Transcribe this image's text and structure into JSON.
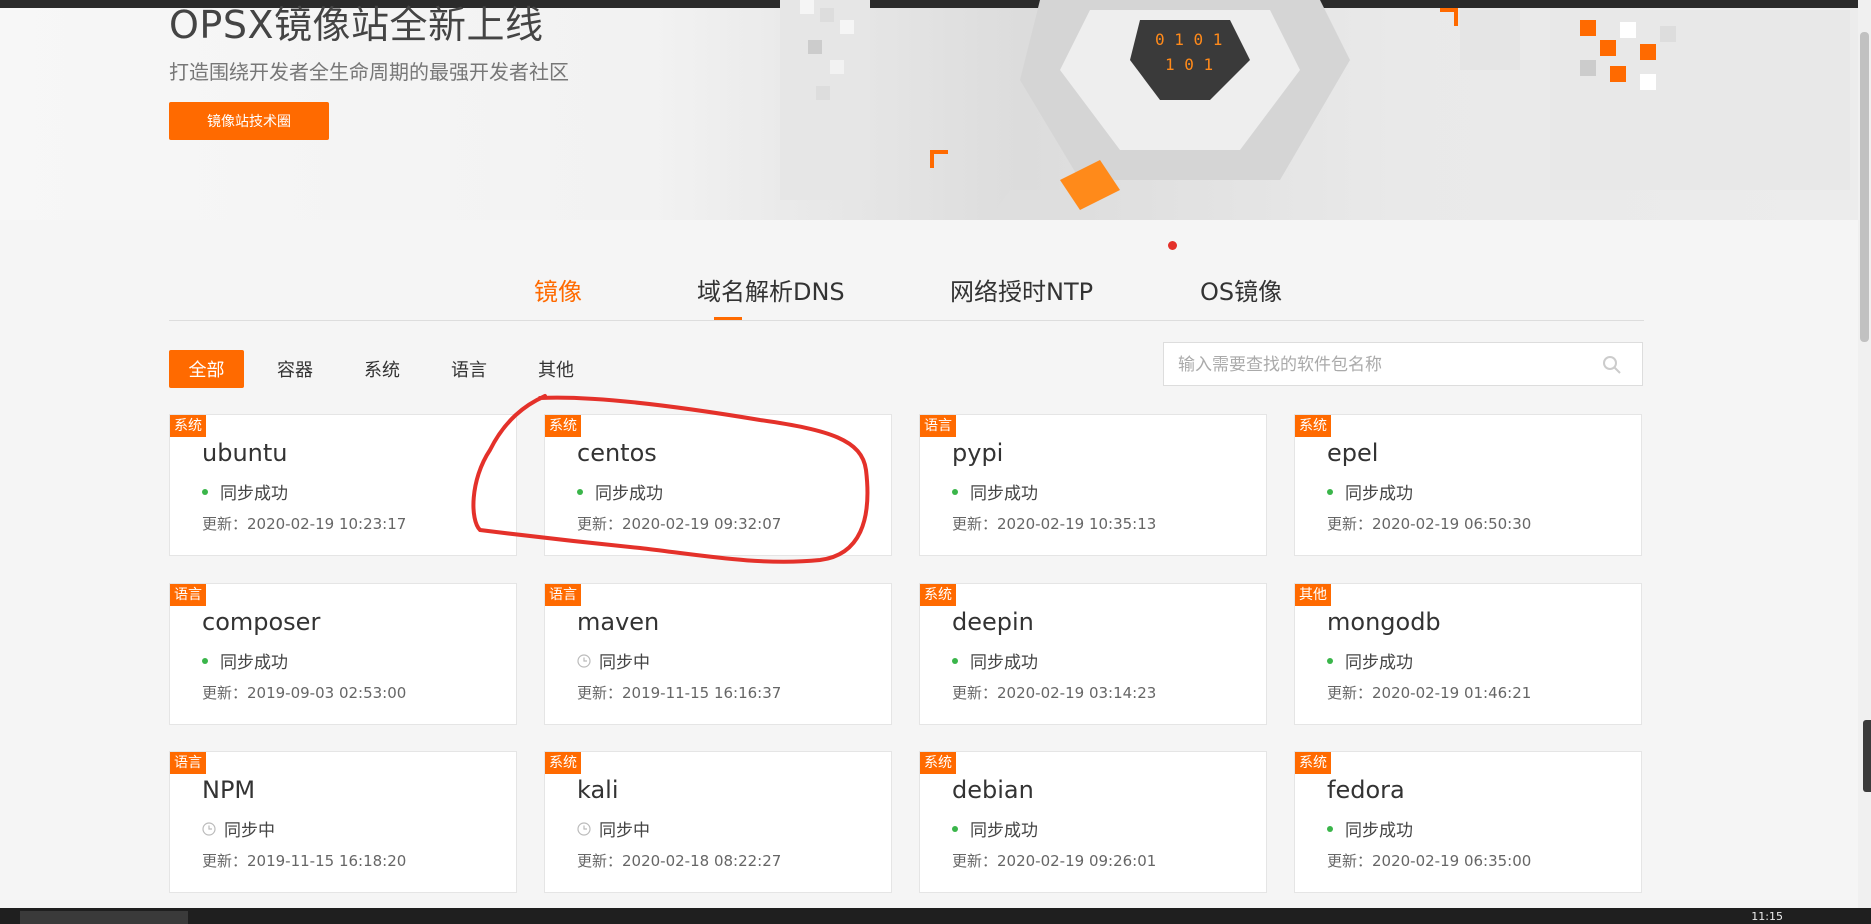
{
  "banner": {
    "title": "OPSX镜像站全新上线",
    "subtitle": "打造围绕开发者全生命周期的最强开发者社区",
    "button_label": "镜像站技术圈"
  },
  "tabs": [
    {
      "label": "镜像",
      "active": true
    },
    {
      "label": "域名解析DNS",
      "active": false
    },
    {
      "label": "网络授时NTP",
      "active": false
    },
    {
      "label": "OS镜像",
      "active": false
    }
  ],
  "filters": [
    {
      "label": "全部",
      "active": true
    },
    {
      "label": "容器",
      "active": false
    },
    {
      "label": "系统",
      "active": false
    },
    {
      "label": "语言",
      "active": false
    },
    {
      "label": "其他",
      "active": false
    }
  ],
  "search": {
    "placeholder": "输入需要查找的软件包名称"
  },
  "mirrors": [
    {
      "tag": "系统",
      "name": "ubuntu",
      "status": "同步成功",
      "state": "success",
      "updated": "更新：2020-02-19 10:23:17"
    },
    {
      "tag": "系统",
      "name": "centos",
      "status": "同步成功",
      "state": "success",
      "updated": "更新：2020-02-19 09:32:07"
    },
    {
      "tag": "语言",
      "name": "pypi",
      "status": "同步成功",
      "state": "success",
      "updated": "更新：2020-02-19 10:35:13"
    },
    {
      "tag": "系统",
      "name": "epel",
      "status": "同步成功",
      "state": "success",
      "updated": "更新：2020-02-19 06:50:30"
    },
    {
      "tag": "语言",
      "name": "composer",
      "status": "同步成功",
      "state": "success",
      "updated": "更新：2019-09-03 02:53:00"
    },
    {
      "tag": "语言",
      "name": "maven",
      "status": "同步中",
      "state": "syncing",
      "updated": "更新：2019-11-15 16:16:37"
    },
    {
      "tag": "系统",
      "name": "deepin",
      "status": "同步成功",
      "state": "success",
      "updated": "更新：2020-02-19 03:14:23"
    },
    {
      "tag": "其他",
      "name": "mongodb",
      "status": "同步成功",
      "state": "success",
      "updated": "更新：2020-02-19 01:46:21"
    },
    {
      "tag": "语言",
      "name": "NPM",
      "status": "同步中",
      "state": "syncing",
      "updated": "更新：2019-11-15 16:18:20"
    },
    {
      "tag": "系统",
      "name": "kali",
      "status": "同步中",
      "state": "syncing",
      "updated": "更新：2020-02-18 08:22:27"
    },
    {
      "tag": "系统",
      "name": "debian",
      "status": "同步成功",
      "state": "success",
      "updated": "更新：2020-02-19 09:26:01"
    },
    {
      "tag": "系统",
      "name": "fedora",
      "status": "同步成功",
      "state": "success",
      "updated": "更新：2020-02-19 06:35:00"
    }
  ],
  "taskbar": {
    "clock": "11:15"
  },
  "colors": {
    "accent": "#ff6a00",
    "success": "#3ab54a",
    "annotation": "#e4312a"
  }
}
